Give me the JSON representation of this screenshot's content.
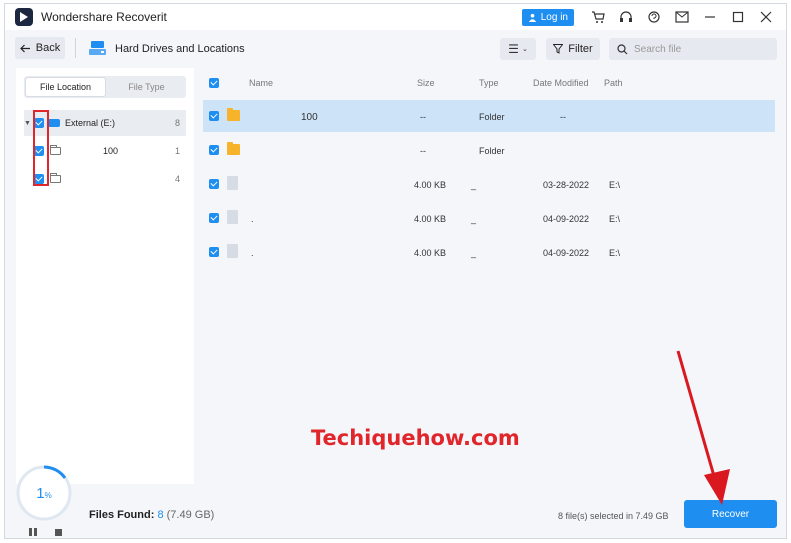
{
  "window": {
    "title": "Wondershare Recoverit",
    "login_label": "Log in",
    "icons": [
      "cart-icon",
      "headset-icon",
      "chat-icon",
      "mail-icon",
      "minimize-icon",
      "maximize-icon",
      "close-icon"
    ]
  },
  "toolbar": {
    "back_label": "Back",
    "location_title": "Hard Drives and Locations",
    "filter_label": "Filter",
    "search_placeholder": "Search file"
  },
  "left_panel": {
    "tabs": [
      "File Location",
      "File Type"
    ],
    "active_tab": 0,
    "tree": [
      {
        "label": "External (E:)",
        "count": "8",
        "checked": true,
        "selected": true
      },
      {
        "label": "100",
        "count": "1",
        "checked": true
      },
      {
        "label": "",
        "count": "4",
        "checked": true
      }
    ]
  },
  "table": {
    "columns": [
      "Name",
      "Size",
      "Type",
      "Date Modified",
      "Path"
    ],
    "rows": [
      {
        "name": "100",
        "size": "--",
        "type": "Folder",
        "date": "--",
        "path": "",
        "icon": "folder-icon",
        "selected": true
      },
      {
        "name": "",
        "size": "--",
        "type": "Folder",
        "date": "",
        "path": "",
        "icon": "folder-icon"
      },
      {
        "name": "",
        "size": "4.00 KB",
        "type": "_",
        "date": "03-28-2022",
        "path": "E:\\",
        "icon": "file-icon"
      },
      {
        "name": ".",
        "size": "4.00 KB",
        "type": "_",
        "date": "04-09-2022",
        "path": "E:\\",
        "icon": "file-icon"
      },
      {
        "name": ".",
        "size": "4.00 KB",
        "type": "_",
        "date": "04-09-2022",
        "path": "E:\\",
        "icon": "file-icon"
      }
    ]
  },
  "bottom": {
    "progress_value": "1",
    "progress_unit": "%",
    "files_found_label": "Files Found:",
    "files_found_count": "8",
    "files_found_size": "(7.49 GB)",
    "selected_text": "8 file(s) selected in 7.49 GB",
    "recover_label": "Recover"
  },
  "watermark": "Techiquehow.com",
  "colors": {
    "accent": "#1f8ef1",
    "annotation": "#e0262a",
    "folder": "#f7b329",
    "selected_row": "#cce3f8"
  }
}
